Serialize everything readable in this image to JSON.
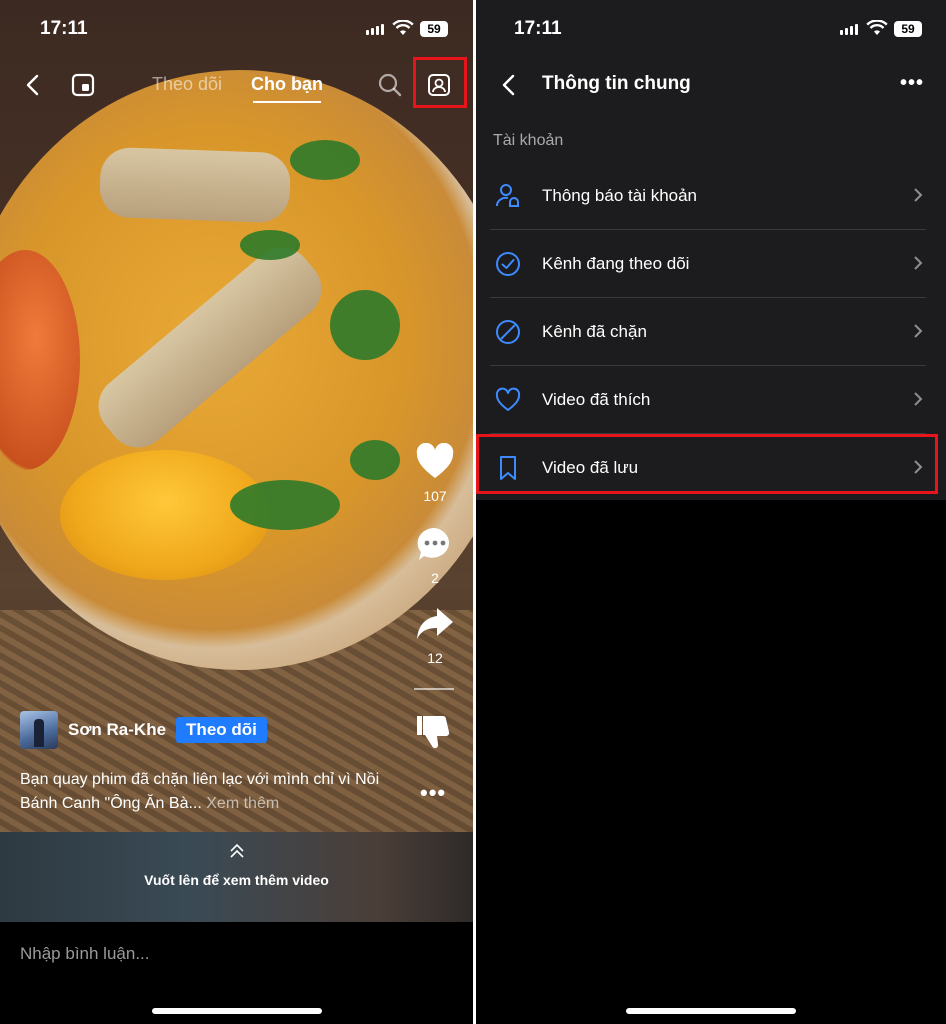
{
  "left": {
    "status": {
      "time": "17:11",
      "battery": "59"
    },
    "nav": {
      "tab_following": "Theo dõi",
      "tab_for_you": "Cho bạn"
    },
    "actions": {
      "likes": "107",
      "comments": "2",
      "shares": "12"
    },
    "author": {
      "name": "Sơn Ra-Khe",
      "follow_label": "Theo dõi"
    },
    "caption": {
      "text": "Bạn quay phim đã chặn liên lạc với mình chỉ vì Nồi Bánh Canh \"Ông Ăn Bà...",
      "see_more": "Xem thêm"
    },
    "more_label": "•••",
    "swipe_text": "Vuốt lên để xem thêm video",
    "comment_placeholder": "Nhập bình luận..."
  },
  "right": {
    "status": {
      "time": "17:11",
      "battery": "59"
    },
    "header": {
      "title": "Thông tin chung",
      "more": "•••"
    },
    "section_label": "Tài khoản",
    "items": [
      {
        "label": "Thông báo tài khoản",
        "icon": "account-notification-icon"
      },
      {
        "label": "Kênh đang theo dõi",
        "icon": "check-circle-icon"
      },
      {
        "label": "Kênh đã chặn",
        "icon": "block-icon"
      },
      {
        "label": "Video đã thích",
        "icon": "heart-icon"
      },
      {
        "label": "Video đã lưu",
        "icon": "bookmark-icon"
      }
    ]
  },
  "colors": {
    "accent_blue": "#1f7cff",
    "icon_blue": "#3d8bff",
    "highlight_red": "#e8141c",
    "panel_bg": "#1c1c1e"
  }
}
